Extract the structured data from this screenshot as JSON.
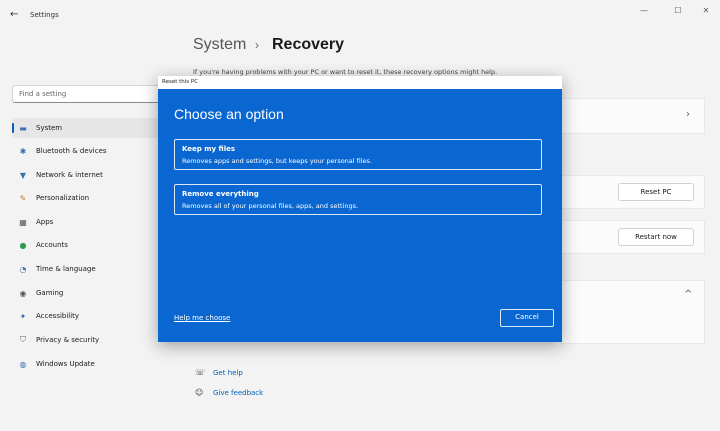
{
  "window": {
    "title": "Settings",
    "back": "←",
    "minimize": "—",
    "maximize": "☐",
    "close": "✕"
  },
  "search": {
    "placeholder": "Find a setting"
  },
  "sidebar": {
    "items": [
      {
        "label": "System",
        "icon": "▬"
      },
      {
        "label": "Bluetooth & devices",
        "icon": "✱"
      },
      {
        "label": "Network & internet",
        "icon": "▼"
      },
      {
        "label": "Personalization",
        "icon": "✎"
      },
      {
        "label": "Apps",
        "icon": "▦"
      },
      {
        "label": "Accounts",
        "icon": "●"
      },
      {
        "label": "Time & language",
        "icon": "◔"
      },
      {
        "label": "Gaming",
        "icon": "◉"
      },
      {
        "label": "Accessibility",
        "icon": "✦"
      },
      {
        "label": "Privacy & security",
        "icon": "⛉"
      },
      {
        "label": "Windows Update",
        "icon": "◍"
      }
    ]
  },
  "breadcrumb": {
    "parent": "System",
    "separator": "›",
    "current": "Recovery"
  },
  "intro": "If you're having problems with your PC or want to reset it, these recovery options might help.",
  "main": {
    "reset_button": "Reset PC",
    "restart_button": "Restart now",
    "chevron_right": "›",
    "chevron_up": "^"
  },
  "links": {
    "help": "Get help",
    "feedback": "Give feedback"
  },
  "dialog": {
    "window_title": "Reset this PC",
    "heading": "Choose an option",
    "options": [
      {
        "title": "Keep my files",
        "description": "Removes apps and settings, but keeps your personal files."
      },
      {
        "title": "Remove everything",
        "description": "Removes all of your personal files, apps, and settings."
      }
    ],
    "help_link": "Help me choose",
    "cancel": "Cancel"
  },
  "colors": {
    "dialog_bg": "#0a66d0",
    "accent": "#005fb8"
  }
}
